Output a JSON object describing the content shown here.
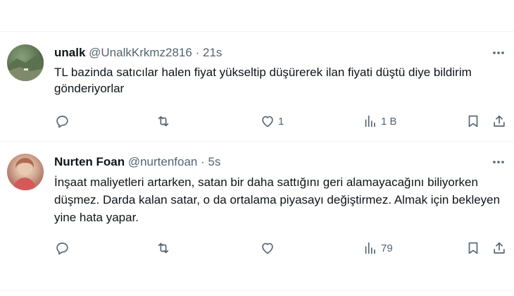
{
  "tweets": [
    {
      "name": "unalk",
      "handle": "@UnalkKrkmz2816",
      "separator": "·",
      "time": "21s",
      "text": "TL bazinda satıcılar halen fiyat yükseltip düşürerek ilan fiyati düştü diye bildirim gönderiyorlar",
      "replies": "",
      "retweets": "",
      "likes": "1",
      "views": "1 B"
    },
    {
      "name": "Nurten Foan",
      "handle": "@nurtenfoan",
      "separator": "·",
      "time": "5s",
      "text": "İnşaat maliyetleri artarken, satan bir daha sattığını geri alamayacağını biliyorken düşmez. Darda kalan satar, o da ortalama piyasayı değiştirmez. Almak için bekleyen yine hata yapar.",
      "replies": "",
      "retweets": "",
      "likes": "",
      "views": "79"
    }
  ],
  "icons": {
    "more": "more-icon",
    "reply": "reply-icon",
    "retweet": "retweet-icon",
    "like": "like-icon",
    "views": "views-icon",
    "bookmark": "bookmark-icon",
    "share": "share-icon"
  },
  "colors": {
    "text": "#0f1419",
    "secondary": "#536471",
    "divider": "#eff3f4"
  }
}
